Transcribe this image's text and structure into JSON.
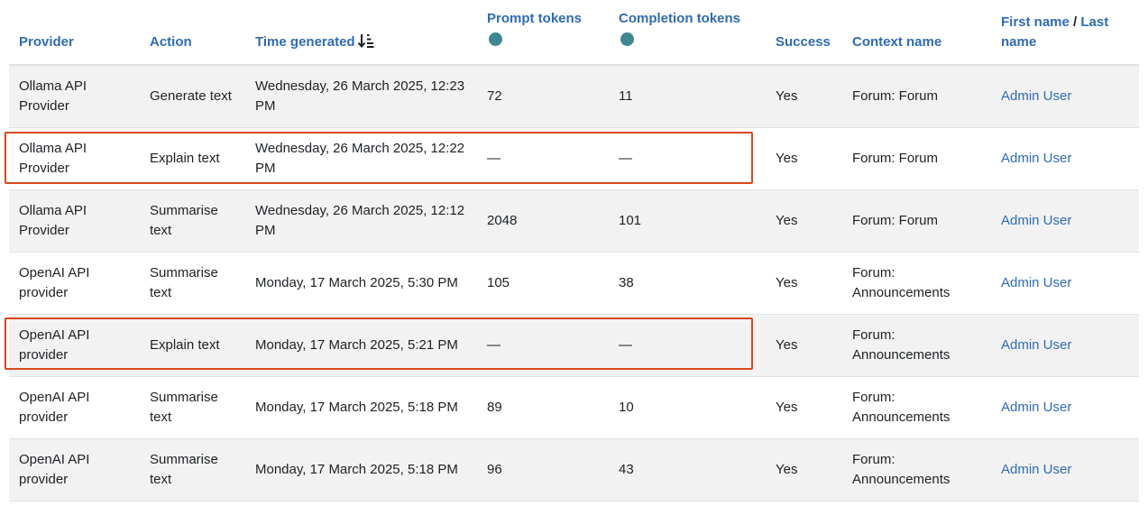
{
  "table": {
    "headers": {
      "provider": "Provider",
      "action": "Action",
      "time_generated": "Time generated",
      "prompt_tokens": "Prompt tokens",
      "completion_tokens": "Completion tokens",
      "success": "Success",
      "context_name": "Context name",
      "first_name": "First name",
      "name_separator": "/",
      "last_name": "Last name"
    },
    "help_glyph": "?",
    "rows": [
      {
        "provider": "Ollama API Provider",
        "action": "Generate text",
        "time": "Wednesday, 26 March 2025, 12:23 PM",
        "prompt_tokens": "72",
        "completion_tokens": "11",
        "success": "Yes",
        "context": "Forum: Forum",
        "user": "Admin User"
      },
      {
        "provider": "Ollama API Provider",
        "action": "Explain text",
        "time": "Wednesday, 26 March 2025, 12:22 PM",
        "prompt_tokens": "—",
        "completion_tokens": "—",
        "success": "Yes",
        "context": "Forum: Forum",
        "user": "Admin User"
      },
      {
        "provider": "Ollama API Provider",
        "action": "Summarise text",
        "time": "Wednesday, 26 March 2025, 12:12 PM",
        "prompt_tokens": "2048",
        "completion_tokens": "101",
        "success": "Yes",
        "context": "Forum: Forum",
        "user": "Admin User"
      },
      {
        "provider": "OpenAI API provider",
        "action": "Summarise text",
        "time": "Monday, 17 March 2025, 5:30 PM",
        "prompt_tokens": "105",
        "completion_tokens": "38",
        "success": "Yes",
        "context": "Forum: Announcements",
        "user": "Admin User"
      },
      {
        "provider": "OpenAI API provider",
        "action": "Explain text",
        "time": "Monday, 17 March 2025, 5:21 PM",
        "prompt_tokens": "—",
        "completion_tokens": "—",
        "success": "Yes",
        "context": "Forum: Announcements",
        "user": "Admin User"
      },
      {
        "provider": "OpenAI API provider",
        "action": "Summarise text",
        "time": "Monday, 17 March 2025, 5:18 PM",
        "prompt_tokens": "89",
        "completion_tokens": "10",
        "success": "Yes",
        "context": "Forum: Announcements",
        "user": "Admin User"
      },
      {
        "provider": "OpenAI API provider",
        "action": "Summarise text",
        "time": "Monday, 17 March 2025, 5:18 PM",
        "prompt_tokens": "96",
        "completion_tokens": "43",
        "success": "Yes",
        "context": "Forum: Announcements",
        "user": "Admin User"
      }
    ]
  },
  "colors": {
    "link": "#2f6bb3",
    "help_icon": "#3f8791",
    "highlight": "#d9471c",
    "striped_row": "#f2f2f2"
  },
  "icons": {
    "sort": "sort-descending-icon",
    "help": "question-circle-icon"
  }
}
